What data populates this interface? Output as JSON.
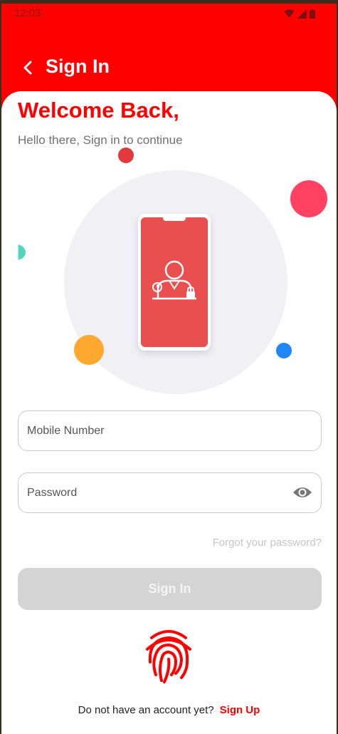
{
  "status_bar": {
    "time": "12:03"
  },
  "appbar": {
    "title": "Sign In"
  },
  "welcome": {
    "heading": "Welcome Back,",
    "subtitle": "Hello there, Sign in to continue"
  },
  "form": {
    "mobile_label": "Mobile Number",
    "password_label": "Password",
    "forgot_link": "Forgot your password?",
    "signin_button": "Sign In"
  },
  "footer": {
    "prompt": "Do not have an account yet?",
    "signup_link": "Sign Up"
  },
  "colors": {
    "primary": "#fe0000",
    "illustration_bg": "#f0f0f5",
    "phone_screen": "#ea4f4f",
    "disabled_button": "#d4d4d4"
  },
  "icons": [
    "back-arrow-icon",
    "wifi-icon",
    "signal-icon",
    "battery-icon",
    "eye-icon",
    "fingerprint-icon"
  ]
}
